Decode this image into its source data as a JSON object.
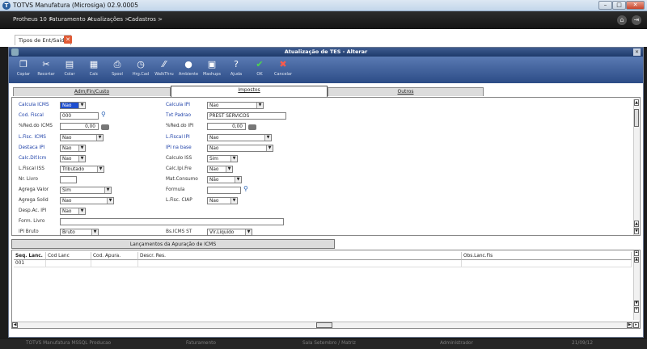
{
  "window": {
    "title": "TOTVS Manufatura (Microsiga) 02.9.0005"
  },
  "menu": {
    "items": [
      "Protheus 10 >",
      "Faturamento >",
      "Atualizações >",
      "Cadastros >"
    ]
  },
  "tab": {
    "label": "Tipos de Ent/Saida"
  },
  "dialog": {
    "title": "Atualização de TES - Alterar",
    "toolbar": [
      "Copiar",
      "Recortar",
      "Colar",
      "Calc",
      "Spool",
      "Hrg.Cad",
      "WalkThru",
      "Ambiente",
      "Mashups",
      "Ajuda",
      "OK",
      "Cancelar"
    ],
    "folders": [
      "Adm/Fin/Custo",
      "Impostos",
      "Outros"
    ],
    "active_folder": "Impostos",
    "left_fields": [
      {
        "label": "Calcula ICMS",
        "value": "Nao",
        "type": "select",
        "required": true
      },
      {
        "label": "Cod. Fiscal",
        "value": "000",
        "type": "lookup",
        "required": true
      },
      {
        "label": "%Red.do ICMS",
        "value": "0,00",
        "type": "number",
        "required": false
      },
      {
        "label": "L.Fisc. ICMS",
        "value": "Nao",
        "type": "select",
        "required": true
      },
      {
        "label": "Destaca IPI",
        "value": "Nao",
        "type": "select",
        "required": true
      },
      {
        "label": "Calc.Dif.Icm",
        "value": "Nao",
        "type": "select",
        "required": true
      },
      {
        "label": "L.Fiscal ISS",
        "value": "Tributado",
        "type": "select",
        "required": false
      },
      {
        "label": "Nr. Livro",
        "value": "",
        "type": "text",
        "required": false
      },
      {
        "label": "Agrega Valor",
        "value": "Sim",
        "type": "select",
        "required": false
      },
      {
        "label": "Agrega Solid",
        "value": "Nao",
        "type": "select",
        "required": false
      },
      {
        "label": "Desp.Ac. IPI",
        "value": "Nao",
        "type": "select",
        "required": false
      },
      {
        "label": "Form. Livro",
        "value": "",
        "type": "text",
        "required": false
      },
      {
        "label": "IPI Bruto",
        "value": "Bruto",
        "type": "select",
        "required": false
      }
    ],
    "right_fields": [
      {
        "label": "Calcula IPI",
        "value": "Nao",
        "type": "select",
        "required": true
      },
      {
        "label": "Txt Padrao",
        "value": "PREST SERVICOS",
        "type": "text",
        "required": true
      },
      {
        "label": "%Red.do IPI",
        "value": "0,00",
        "type": "number",
        "required": false
      },
      {
        "label": "L.Fiscal IPI",
        "value": "Nao",
        "type": "select",
        "required": true
      },
      {
        "label": "IPI na base",
        "value": "Nao",
        "type": "select",
        "required": true
      },
      {
        "label": "Calculo ISS",
        "value": "Sim",
        "type": "select",
        "required": false
      },
      {
        "label": "Calc.Ipi.Fre",
        "value": "Nao",
        "type": "select",
        "required": false
      },
      {
        "label": "Mat.Consumo",
        "value": "Não",
        "type": "select",
        "required": false
      },
      {
        "label": "Formula",
        "value": "",
        "type": "lookup",
        "required": false
      },
      {
        "label": "L.Fisc. CIAP",
        "value": "Nao",
        "type": "select",
        "required": false
      },
      {
        "label": "Bs.ICMS ST",
        "value": "Vlr.Liquido",
        "type": "select",
        "required": false
      }
    ],
    "grid": {
      "tab_label": "Lançamentos da Apuração de ICMS",
      "columns": [
        "Seq. Lanc.",
        "Cod Lanc",
        "Cod. Apura.",
        "Descr. Res.",
        "Obs.Lanc.Fis"
      ],
      "rows": [
        [
          "001",
          "",
          "",
          "",
          ""
        ]
      ]
    }
  },
  "status": {
    "items": [
      "TOTVS Manufatura MSSQL Producao",
      "Faturamento",
      "Sala Setembro / Matriz",
      "Administrador",
      "21/09/12"
    ]
  },
  "colors": {
    "required_label": "#1c3fa8",
    "toolbar_bg": "#3b5b96",
    "title_bg": "#2a4a7e"
  }
}
